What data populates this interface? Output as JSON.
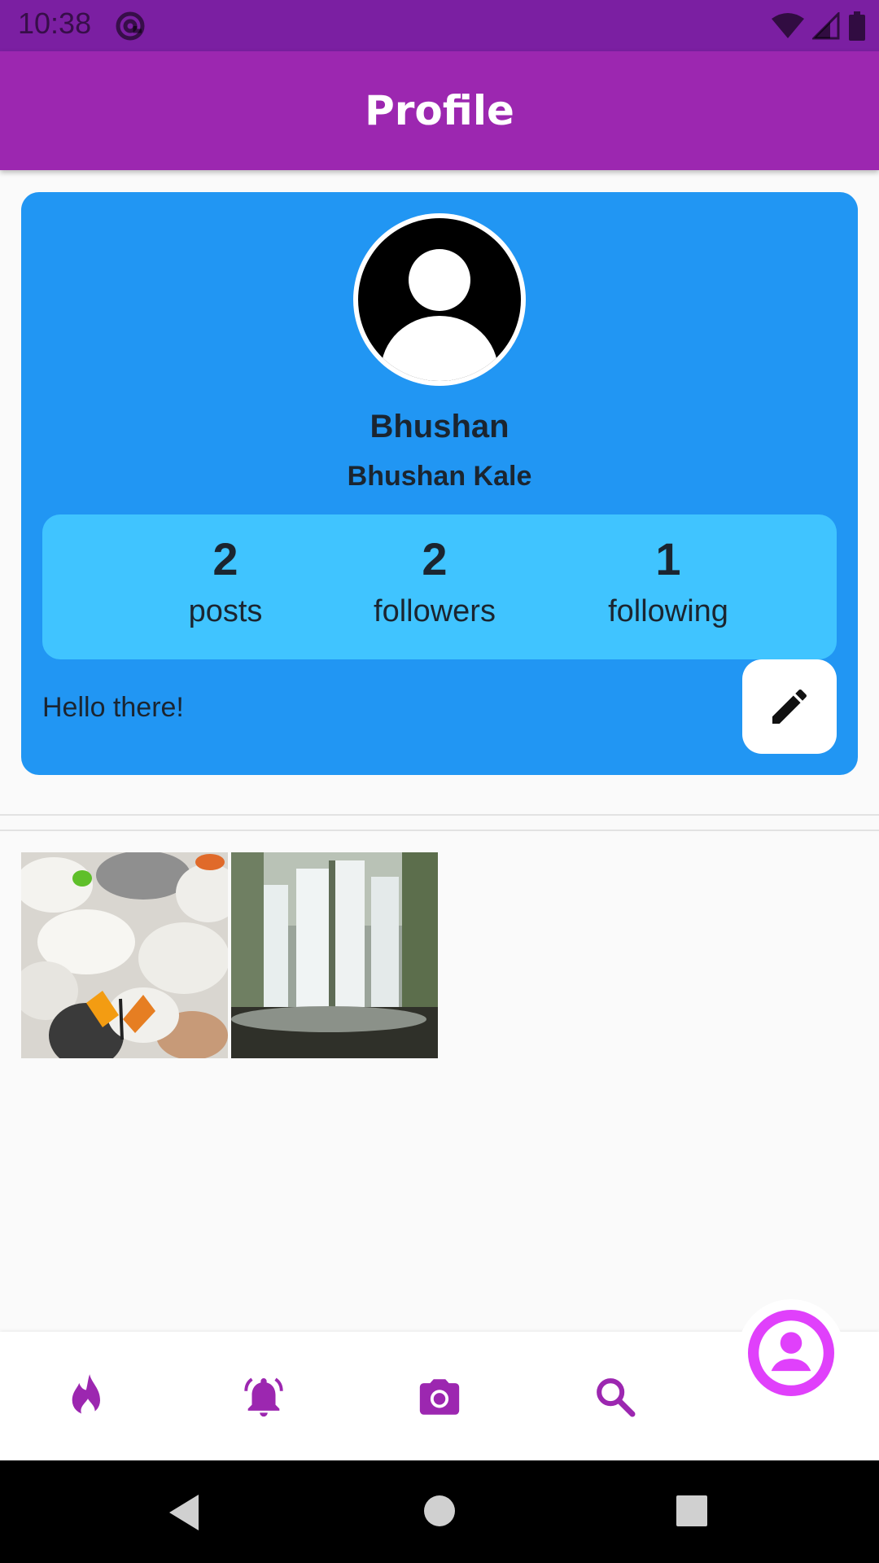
{
  "status_bar": {
    "time": "10:38"
  },
  "app_bar": {
    "title": "Profile"
  },
  "profile": {
    "username": "Bhushan",
    "full_name": "Bhushan Kale",
    "bio": "Hello there!",
    "stats": [
      {
        "count": "2",
        "label": "posts"
      },
      {
        "count": "2",
        "label": "followers"
      },
      {
        "count": "1",
        "label": "following"
      }
    ]
  },
  "posts": [
    {
      "icon": "pebbles-butterfly-photo"
    },
    {
      "icon": "waterfall-photo"
    }
  ],
  "bottom_nav": {
    "items": [
      "fire-icon",
      "bell-icon",
      "camera-icon",
      "search-icon",
      "account-circle-icon"
    ],
    "accent": "#9c27b0",
    "active_accent": "#e040fb"
  },
  "colors": {
    "status_bar": "#7b1fa2",
    "app_bar": "#9c27b0",
    "card": "#2196f3",
    "stats_box": "#40c4ff"
  }
}
